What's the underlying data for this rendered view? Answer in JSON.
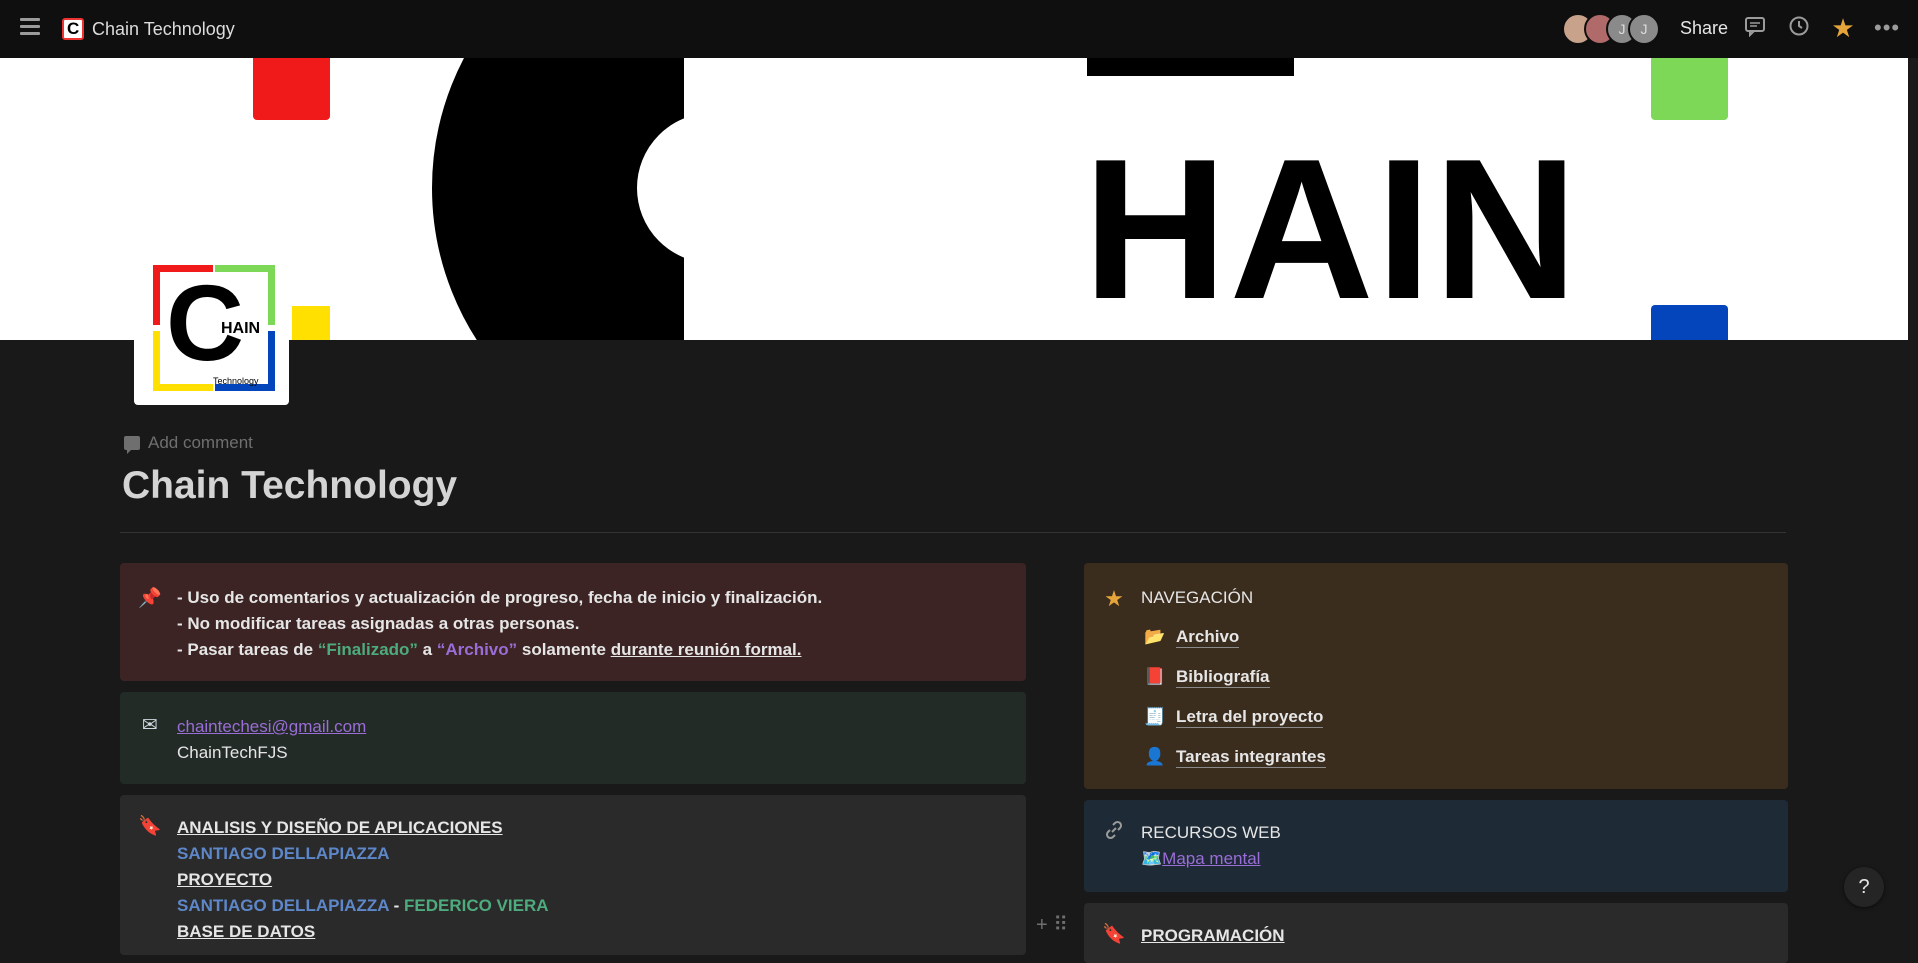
{
  "topbar": {
    "workspace_title": "Chain Technology",
    "avatars": [
      "",
      "",
      "J",
      "J"
    ],
    "share_label": "Share"
  },
  "cover": {
    "text": "HAIN"
  },
  "page_icon": {
    "c": "C",
    "hain": "HAIN",
    "tech": "Technology"
  },
  "page": {
    "add_comment": "Add comment",
    "title": "Chain Technology"
  },
  "rules": {
    "line1": "- Uso de comentarios y actualización de progreso, fecha de inicio y finalización.",
    "line2": "- No modificar tareas asignadas a otras personas.",
    "line3_a": "- Pasar tareas de ",
    "line3_fin": "“Finalizado”",
    "line3_b": " a ",
    "line3_arch": "“Archivo”",
    "line3_c": " solamente ",
    "line3_d": "durante reunión formal."
  },
  "contact": {
    "email": "chaintechesi@gmail.com",
    "handle": "ChainTechFJS"
  },
  "subjects": {
    "s1_title": "ANALISIS Y DISEÑO DE APLICACIONES",
    "s1_people": "SANTIAGO DELLAPIAZZA",
    "s2_title": "PROYECTO",
    "s2_person1": "SANTIAGO DELLAPIAZZA",
    "s2_sep": " - ",
    "s2_person2": "FEDERICO VIERA",
    "s3_title": "BASE DE DATOS"
  },
  "navigation": {
    "heading": "NAVEGACIÓN",
    "items": [
      {
        "label": "Archivo",
        "icon": "folder-icon"
      },
      {
        "label": "Bibliografía",
        "icon": "book-icon"
      },
      {
        "label": "Letra del proyecto",
        "icon": "document-icon"
      },
      {
        "label": "Tareas integrantes",
        "icon": "person-icon"
      }
    ]
  },
  "resources": {
    "heading": "RECURSOS WEB",
    "link": "Mapa mental"
  },
  "programming": {
    "heading": "PROGRAMACIÓN"
  },
  "help_label": "?"
}
